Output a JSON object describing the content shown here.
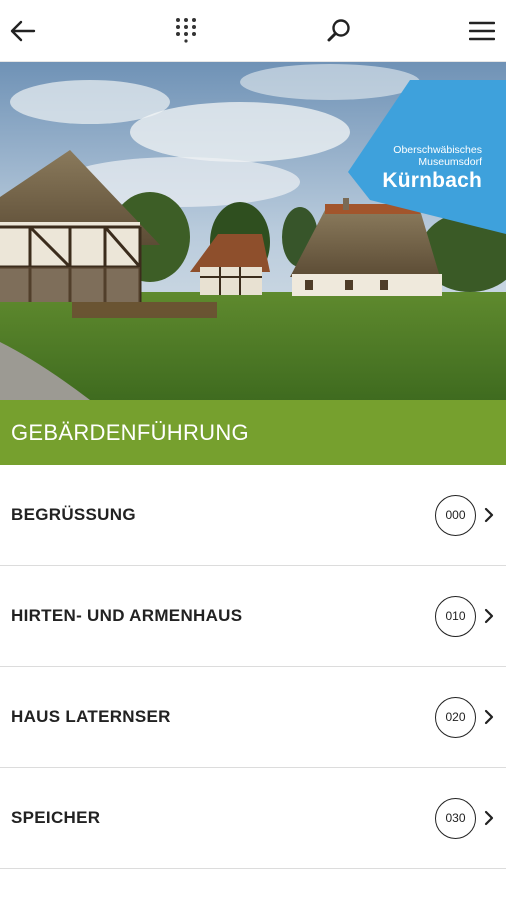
{
  "topbar": {
    "icons": [
      "back-arrow-icon",
      "keypad-grid-icon",
      "search-icon",
      "hamburger-menu-icon"
    ]
  },
  "hero": {
    "logo": {
      "line1": "Oberschwäbisches",
      "line2": "Museumsdorf",
      "name": "Kürnbach"
    },
    "colors": {
      "badge": "#3ea1dc"
    }
  },
  "section": {
    "title": "GEBÄRDENFÜHRUNG",
    "color": "#76a02e"
  },
  "items": [
    {
      "label": "BEGRÜSSUNG",
      "number": "000"
    },
    {
      "label": "HIRTEN- UND ARMENHAUS",
      "number": "010"
    },
    {
      "label": "HAUS LATERNSER",
      "number": "020"
    },
    {
      "label": "SPEICHER",
      "number": "030"
    }
  ]
}
